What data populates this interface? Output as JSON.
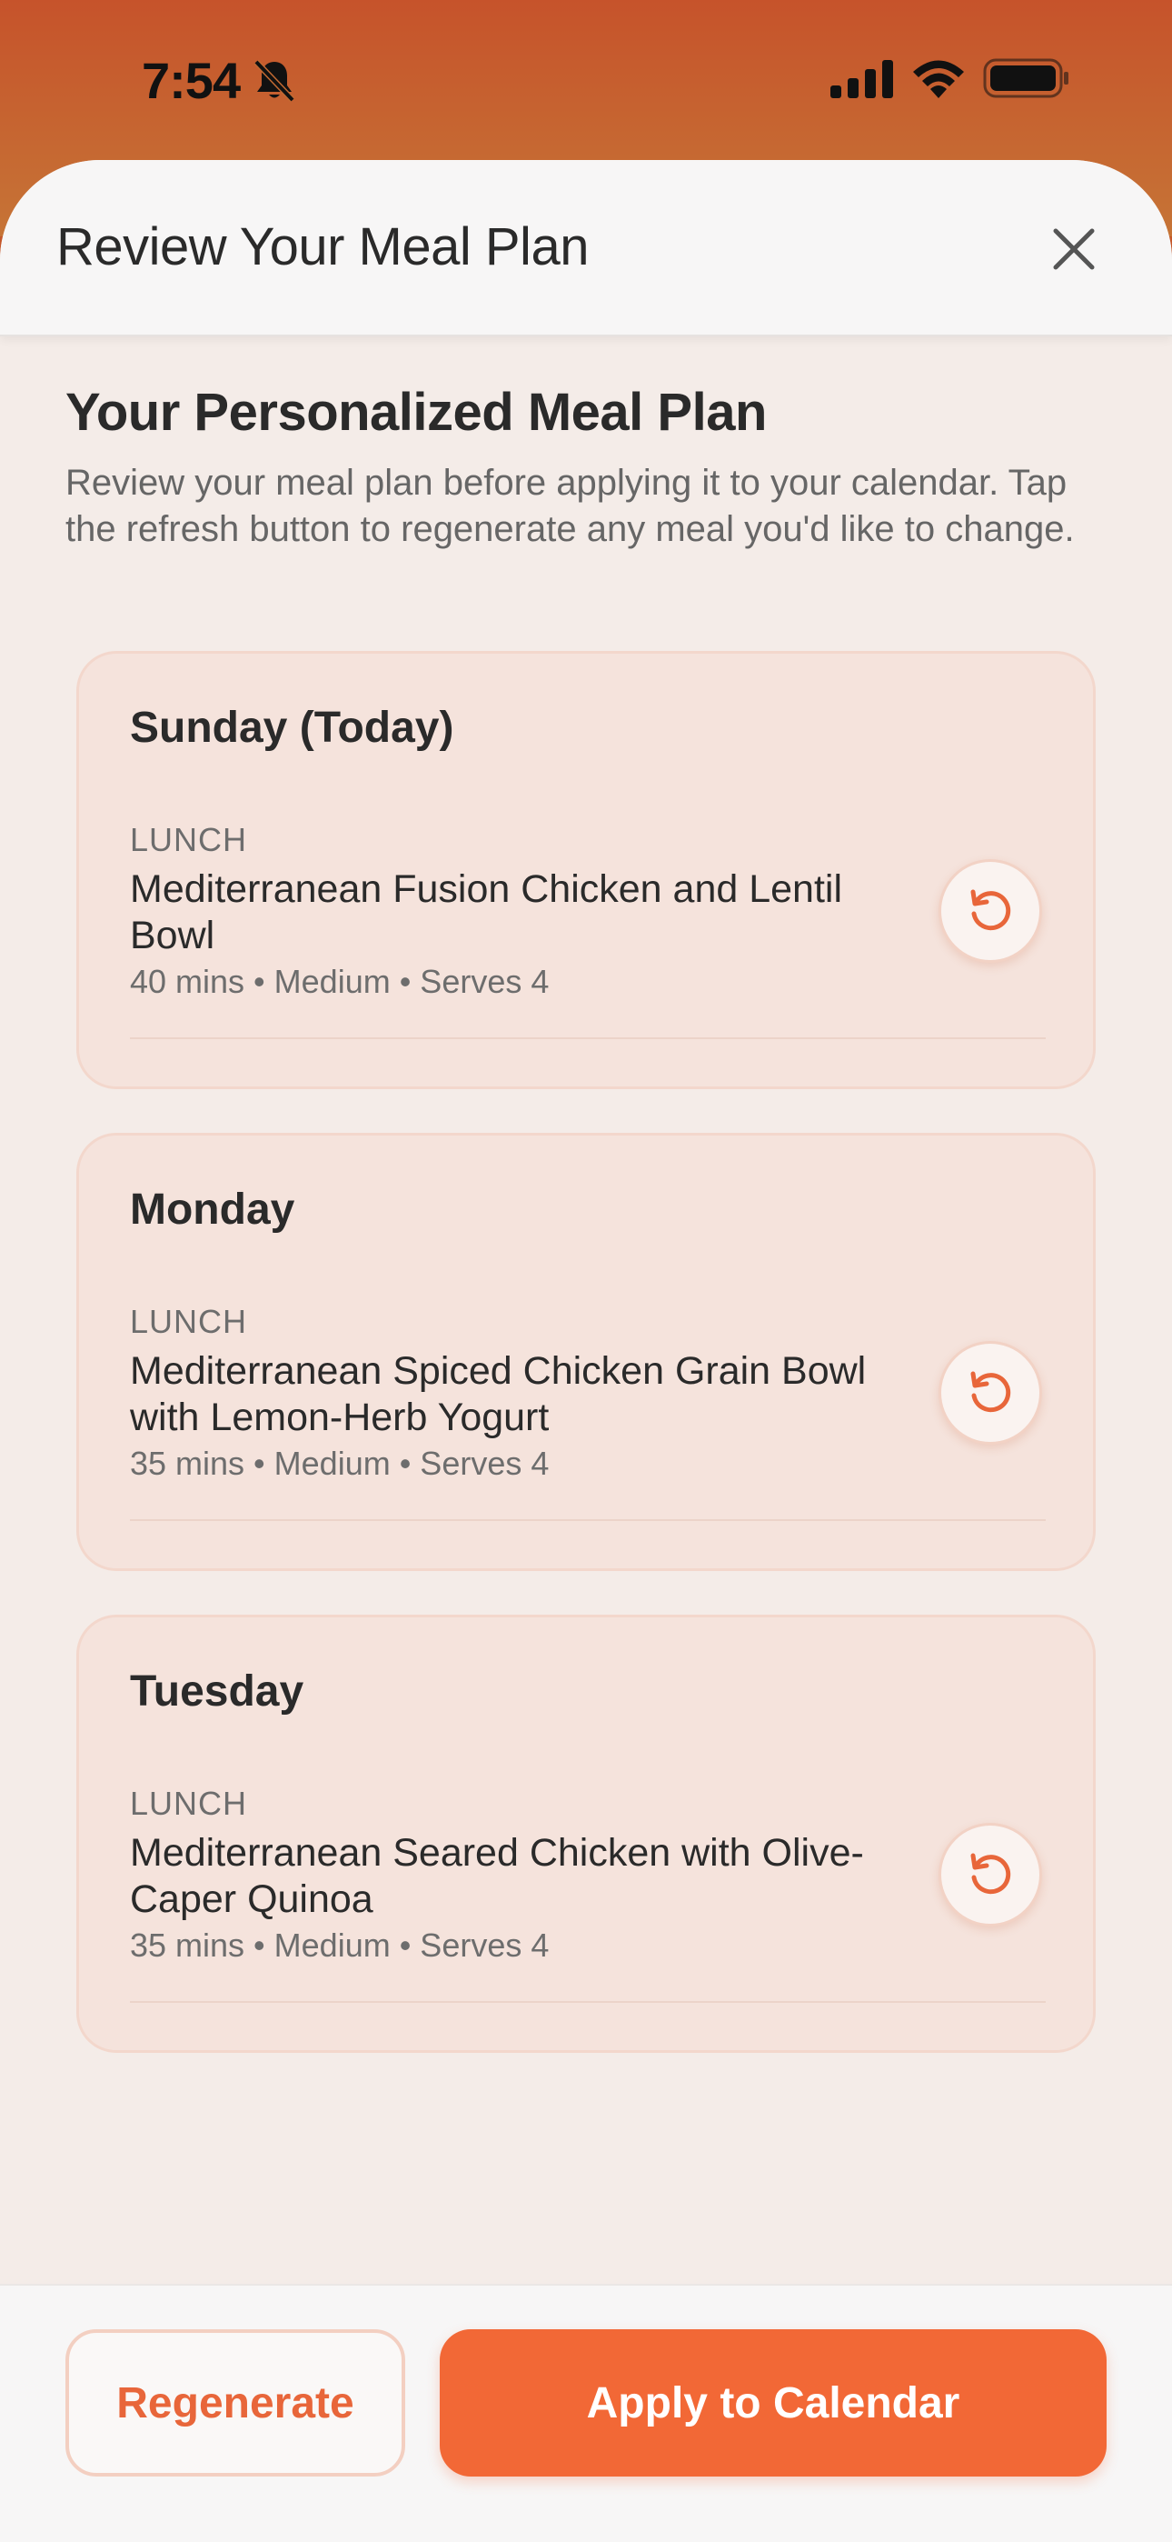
{
  "status_bar": {
    "time": "7:54",
    "icons": [
      "bell-slash-icon",
      "cellular-signal-icon",
      "wifi-icon",
      "battery-icon"
    ]
  },
  "header": {
    "title": "Review Your Meal Plan",
    "close_icon": "close-icon"
  },
  "intro": {
    "heading": "Your Personalized Meal Plan",
    "description": "Review your meal plan before applying it to your calendar. Tap the refresh button to regenerate any meal you'd like to change."
  },
  "days": [
    {
      "day": "Sunday (Today)",
      "meal_type": "LUNCH",
      "meal_name": "Mediterranean Fusion Chicken and Lentil Bowl",
      "meta": "40 mins • Medium • Serves 4"
    },
    {
      "day": "Monday",
      "meal_type": "LUNCH",
      "meal_name": "Mediterranean Spiced Chicken Grain Bowl with Lemon-Herb Yogurt",
      "meta": "35 mins • Medium • Serves 4"
    },
    {
      "day": "Tuesday",
      "meal_type": "LUNCH",
      "meal_name": "Mediterranean Seared Chicken with Olive-Caper Quinoa",
      "meta": "35 mins • Medium • Serves 4"
    }
  ],
  "actions": {
    "regenerate_label": "Regenerate",
    "apply_label": "Apply to Calendar"
  },
  "colors": {
    "accent": "#f26836",
    "card_bg": "#f5e3dc",
    "sheet_bg": "#f4ece8",
    "header_gradient_top": "#c6532b",
    "header_gradient_bottom": "#c67436"
  }
}
